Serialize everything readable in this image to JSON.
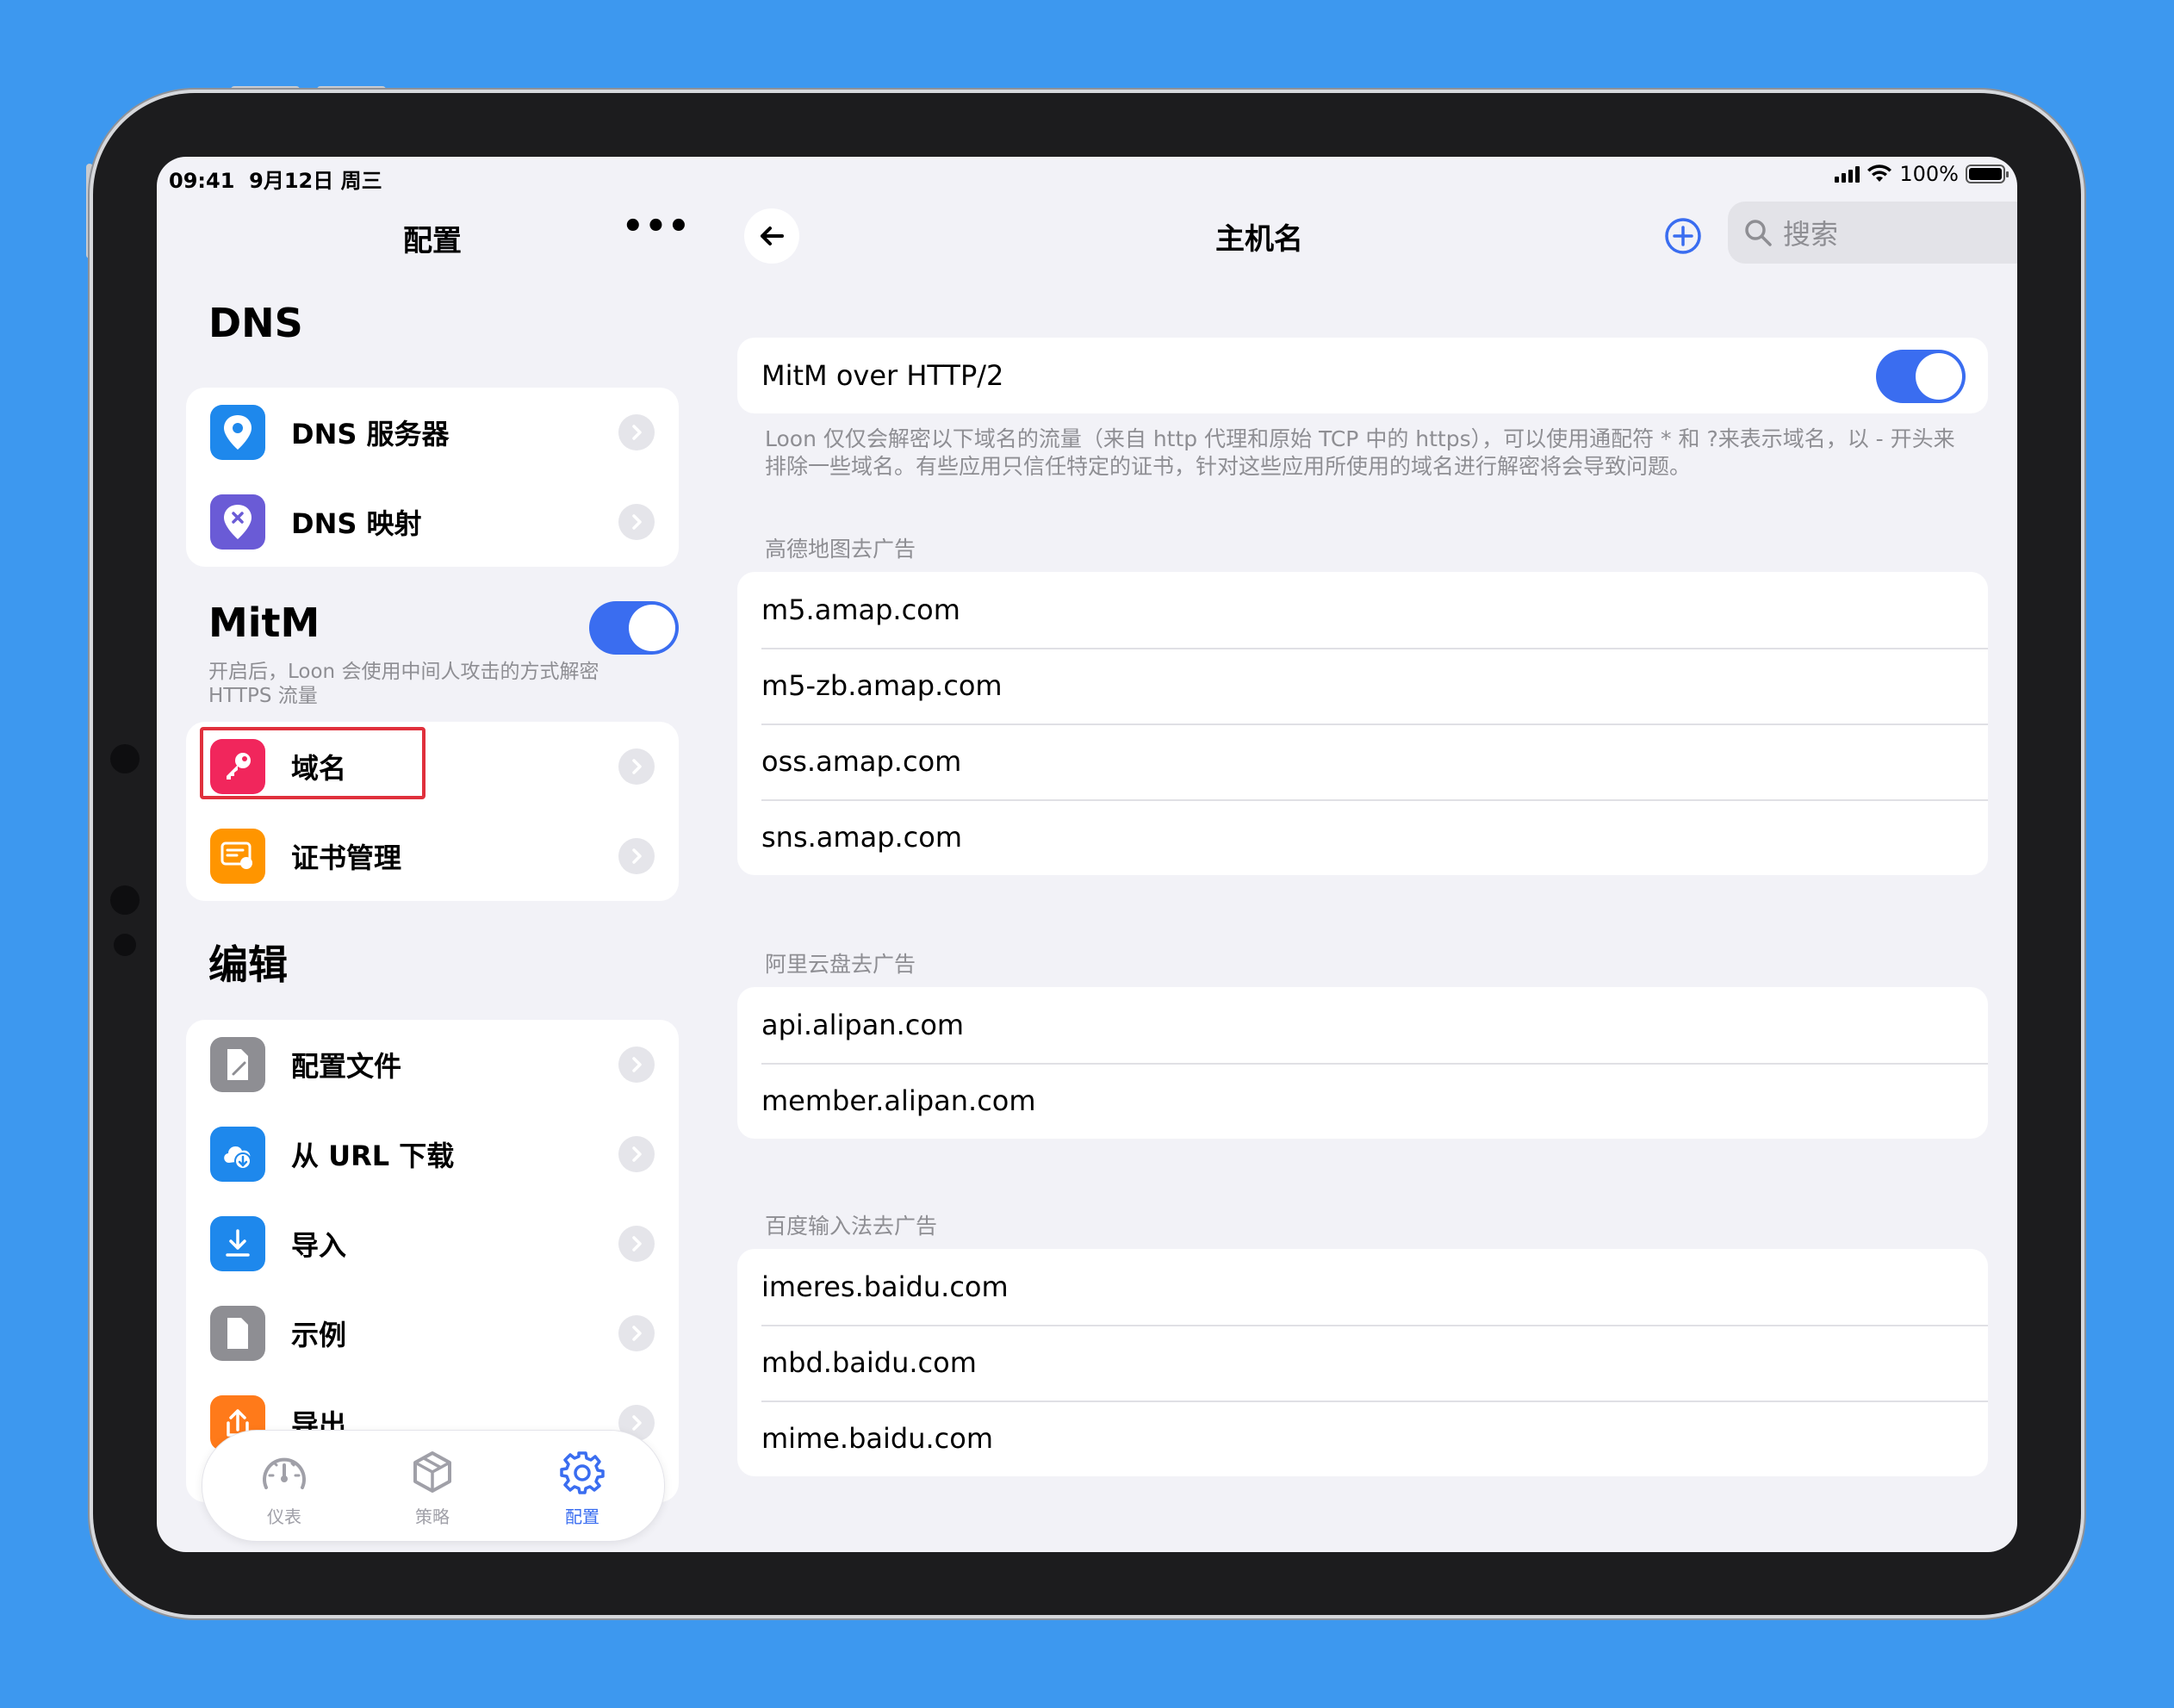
{
  "status": {
    "time": "09:41",
    "date": "9月12日 周三",
    "battery": "100%"
  },
  "sidebar": {
    "title": "配置",
    "more": "•••",
    "dns": {
      "header": "DNS",
      "items": [
        {
          "label": "DNS 服务器",
          "icon": "location-pin-icon"
        },
        {
          "label": "DNS 映射",
          "icon": "pin-x-icon"
        }
      ]
    },
    "mitm": {
      "header": "MitM",
      "enabled": true,
      "note": "开启后，Loon 会使用中间人攻击的方式解密 HTTPS 流量",
      "items": [
        {
          "label": "域名",
          "icon": "key-icon"
        },
        {
          "label": "证书管理",
          "icon": "certificate-icon"
        }
      ]
    },
    "edit": {
      "header": "编辑",
      "items": [
        {
          "label": "配置文件",
          "icon": "doc-edit-icon"
        },
        {
          "label": "从 URL 下载",
          "icon": "cloud-download-icon"
        },
        {
          "label": "导入",
          "icon": "import-icon"
        },
        {
          "label": "示例",
          "icon": "doc-icon"
        },
        {
          "label": "导出",
          "icon": "export-icon"
        }
      ]
    },
    "tabs": [
      {
        "label": "仪表",
        "icon": "gauge-icon",
        "active": false
      },
      {
        "label": "策略",
        "icon": "cube-icon",
        "active": false
      },
      {
        "label": "配置",
        "icon": "gear-icon",
        "active": true
      }
    ]
  },
  "detail": {
    "title": "主机名",
    "search_placeholder": "搜索",
    "http2": {
      "label": "MitM over HTTP/2",
      "enabled": true
    },
    "footnote": "Loon 仅仅会解密以下域名的流量（来自 http 代理和原始 TCP 中的 https），可以使用通配符 * 和 ?来表示域名，以 - 开头来排除一些域名。有些应用只信任特定的证书，针对这些应用所使用的域名进行解密将会导致问题。",
    "groups": [
      {
        "name": "高德地图去广告",
        "hosts": [
          "m5.amap.com",
          "m5-zb.amap.com",
          "oss.amap.com",
          "sns.amap.com"
        ]
      },
      {
        "name": "阿里云盘去广告",
        "hosts": [
          "api.alipan.com",
          "member.alipan.com"
        ]
      },
      {
        "name": "百度输入法去广告",
        "hosts": [
          "imeres.baidu.com",
          "mbd.baidu.com",
          "mime.baidu.com"
        ]
      }
    ]
  },
  "colors": {
    "accent": "#3a6df0",
    "background": "#3d98ef",
    "highlight": "#e0303c"
  }
}
